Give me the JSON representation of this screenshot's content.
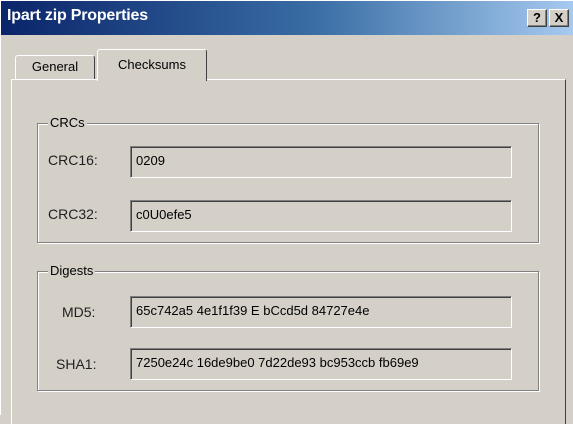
{
  "window": {
    "title": "Ipart zip Properties",
    "help_label": "?",
    "close_label": "X"
  },
  "tabs": [
    {
      "label": "General",
      "selected": false
    },
    {
      "label": "Checksums",
      "selected": true
    }
  ],
  "crc_group": {
    "title": "CRCs",
    "fields": [
      {
        "label": "CRC16:",
        "value": "0209"
      },
      {
        "label": "CRC32:",
        "value": "c0U0efe5"
      }
    ]
  },
  "digests_group": {
    "title": "Digests",
    "fields": [
      {
        "label": "MD5:",
        "value": "65c742a5 4e1f1f39 E bCcd5d 84727e4e"
      },
      {
        "label": "SHA1:",
        "value": "7250e24c 16de9be0 7d22de93 bc953ccb fb69e9"
      }
    ]
  }
}
